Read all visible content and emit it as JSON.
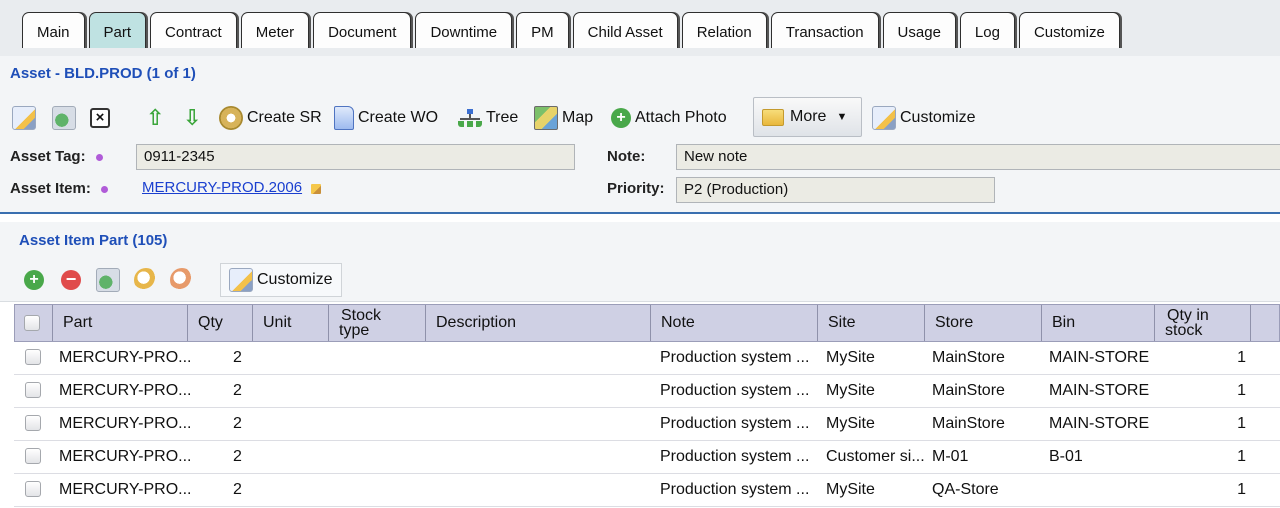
{
  "tabs": [
    "Main",
    "Part",
    "Contract",
    "Meter",
    "Document",
    "Downtime",
    "PM",
    "Child Asset",
    "Relation",
    "Transaction",
    "Usage",
    "Log",
    "Customize"
  ],
  "active_tab": "Part",
  "asset_title": "Asset - BLD.PROD (1 of 1)",
  "toolbar": {
    "create_sr": "Create SR",
    "create_wo": "Create WO",
    "tree": "Tree",
    "map": "Map",
    "attach_photo": "Attach Photo",
    "more": "More",
    "customize": "Customize"
  },
  "form": {
    "asset_tag_label": "Asset Tag:",
    "asset_tag_value": "0911-2345",
    "asset_item_label": "Asset Item:",
    "asset_item_value": "MERCURY-PROD.2006",
    "note_label": "Note:",
    "note_value": "New note",
    "priority_label": "Priority:",
    "priority_value": "P2 (Production)"
  },
  "parts": {
    "title": "Asset Item Part (105)",
    "customize": "Customize",
    "columns": {
      "part": "Part",
      "qty": "Qty",
      "unit": "Unit",
      "stock_type_1": "Stock",
      "stock_type_2": "type",
      "description": "Description",
      "note": "Note",
      "site": "Site",
      "store": "Store",
      "bin": "Bin",
      "qty_in_stock_1": "Qty in",
      "qty_in_stock_2": "stock"
    },
    "rows": [
      {
        "part": "MERCURY-PRO...",
        "qty": "2",
        "unit": "",
        "stock_type": "",
        "description": "",
        "note": "Production system ...",
        "site": "MySite",
        "store": "MainStore",
        "bin": "MAIN-STORE",
        "qty_in_stock": "1"
      },
      {
        "part": "MERCURY-PRO...",
        "qty": "2",
        "unit": "",
        "stock_type": "",
        "description": "",
        "note": "Production system ...",
        "site": "MySite",
        "store": "MainStore",
        "bin": "MAIN-STORE",
        "qty_in_stock": "1"
      },
      {
        "part": "MERCURY-PRO...",
        "qty": "2",
        "unit": "",
        "stock_type": "",
        "description": "",
        "note": "Production system ...",
        "site": "MySite",
        "store": "MainStore",
        "bin": "MAIN-STORE",
        "qty_in_stock": "1"
      },
      {
        "part": "MERCURY-PRO...",
        "qty": "2",
        "unit": "",
        "stock_type": "",
        "description": "",
        "note": "Production system ...",
        "site": "Customer si...",
        "store": "M-01",
        "bin": "B-01",
        "qty_in_stock": "1"
      },
      {
        "part": "MERCURY-PRO...",
        "qty": "2",
        "unit": "",
        "stock_type": "",
        "description": "",
        "note": "Production system ...",
        "site": "MySite",
        "store": "QA-Store",
        "bin": "",
        "qty_in_stock": "1"
      }
    ]
  },
  "colors": {
    "title_blue": "#1f4fb8",
    "active_tab": "#bfe2e2",
    "grid_header": "#cfd0e4",
    "link": "#1a3fcf"
  }
}
